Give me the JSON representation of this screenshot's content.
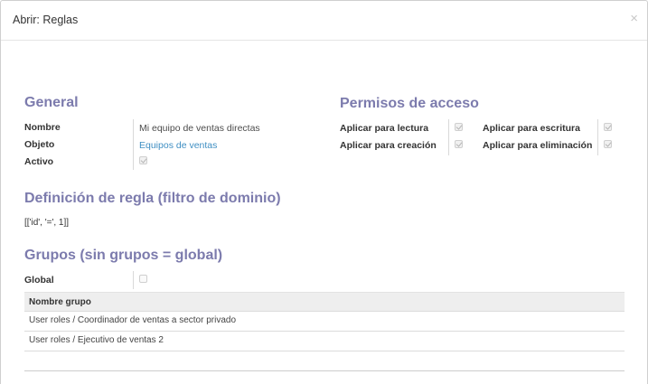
{
  "dialog": {
    "title": "Abrir: Reglas",
    "close_label": "×"
  },
  "general": {
    "title": "General",
    "fields": [
      {
        "label": "Nombre",
        "value": "Mi equipo de ventas directas"
      },
      {
        "label": "Objeto",
        "value": "Equipos de ventas"
      },
      {
        "label": "Activo",
        "checked": true
      }
    ]
  },
  "permissions": {
    "title": "Permisos de acceso",
    "items": [
      {
        "label": "Aplicar para lectura",
        "checked": true
      },
      {
        "label": "Aplicar para escritura",
        "checked": true
      },
      {
        "label": "Aplicar para creación",
        "checked": true
      },
      {
        "label": "Aplicar para eliminación",
        "checked": true
      }
    ]
  },
  "domain": {
    "title": "Definición de regla (filtro de dominio)",
    "value": "[['id', '=', 1]]"
  },
  "groups": {
    "title": "Grupos (sin grupos = global)",
    "global_label": "Global",
    "global_checked": false,
    "table_header": "Nombre grupo",
    "rows": [
      "User roles / Coordinador de ventas a sector privado",
      "User roles / Ejecutivo de ventas 2"
    ]
  },
  "colors": {
    "section_title": "#7c7bad",
    "link": "#3f8fc3"
  }
}
